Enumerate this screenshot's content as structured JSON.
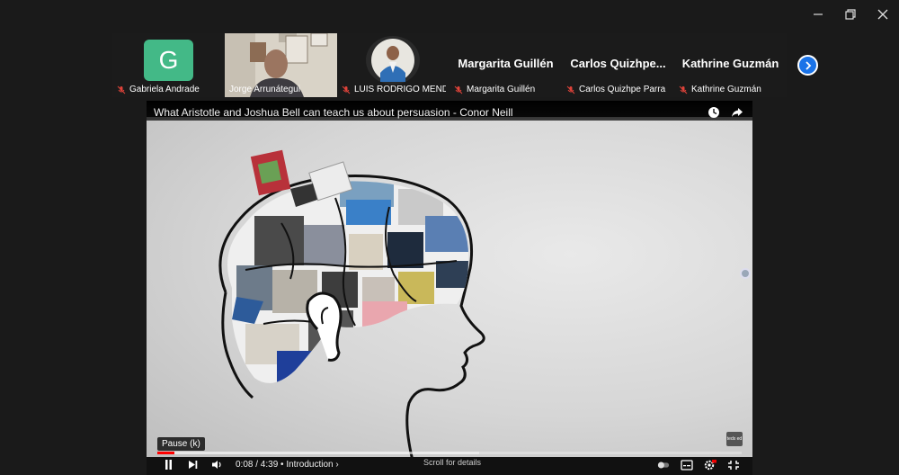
{
  "window": {
    "controls": [
      "minimize",
      "restore",
      "close"
    ]
  },
  "participants": [
    {
      "name": "Gabriela Andrade",
      "initial": "G",
      "muted": true,
      "kind": "avatar",
      "avatar_color": "#43b987"
    },
    {
      "name": "Jorge Arrunátegui",
      "muted": false,
      "kind": "video"
    },
    {
      "name": "LUIS RODRIGO MENDI...",
      "muted": true,
      "kind": "video",
      "active": true
    },
    {
      "name": "Margarita Guillén",
      "display": "Margarita Guillén",
      "muted": true,
      "kind": "name"
    },
    {
      "name": "Carlos Quizhpe Parra",
      "display": "Carlos  Quizhpe...",
      "muted": true,
      "kind": "name"
    },
    {
      "name": "Kathrine Guzmán",
      "display": "Kathrine Guzmán",
      "muted": true,
      "kind": "name"
    }
  ],
  "player": {
    "title": "What Aristotle and Joshua Bell can teach us about persuasion - Conor Neill",
    "tooltip": "Pause (k)",
    "time": "0:08 / 4:39",
    "chapter": "• Introduction ›",
    "scroll_hint": "Scroll for details",
    "progress_played": 0.029,
    "progress_loaded": 0.55,
    "logo_badge": "tedx ed"
  },
  "colors": {
    "active_border": "#3ecf6e",
    "next_button": "#1a73e8",
    "progress": "#ff0000",
    "mute": "#e0433a"
  }
}
